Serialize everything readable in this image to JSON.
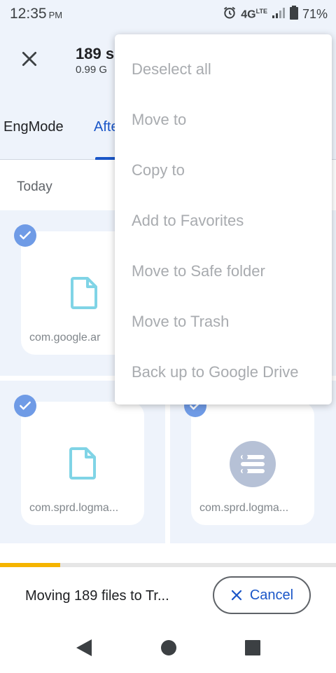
{
  "status_bar": {
    "time": "12:35",
    "ampm": "PM",
    "network": "4G",
    "network_sup": "LTE",
    "battery": "71%"
  },
  "app_bar": {
    "title": "189 s",
    "subtitle": "0.99 G"
  },
  "tabs": [
    {
      "label": "EngMode"
    },
    {
      "label": "Afte"
    }
  ],
  "section": {
    "header": "Today"
  },
  "files": [
    {
      "label": "com.google.ar",
      "icon": "file-icon",
      "selected": true
    },
    {
      "label": "com.sprd.logma...",
      "icon": "file-icon",
      "selected": true
    },
    {
      "label": "com.sprd.logma...",
      "icon": "app-icon",
      "selected": true
    }
  ],
  "menu": {
    "items": [
      {
        "label": "Deselect all"
      },
      {
        "label": "Move to"
      },
      {
        "label": "Copy to"
      },
      {
        "label": "Add to Favorites"
      },
      {
        "label": "Move to Safe folder"
      },
      {
        "label": "Move to Trash"
      },
      {
        "label": "Back up to Google Drive"
      }
    ]
  },
  "progress": {
    "fraction": 0.18
  },
  "snackbar": {
    "text": "Moving 189 files to Tr...",
    "cancel_label": "Cancel"
  },
  "colors": {
    "accent": "#1a56c8",
    "progress": "#f5b400",
    "check": "#6f9be6",
    "background": "#eef3fb",
    "file_icon": "#80d4e6"
  }
}
